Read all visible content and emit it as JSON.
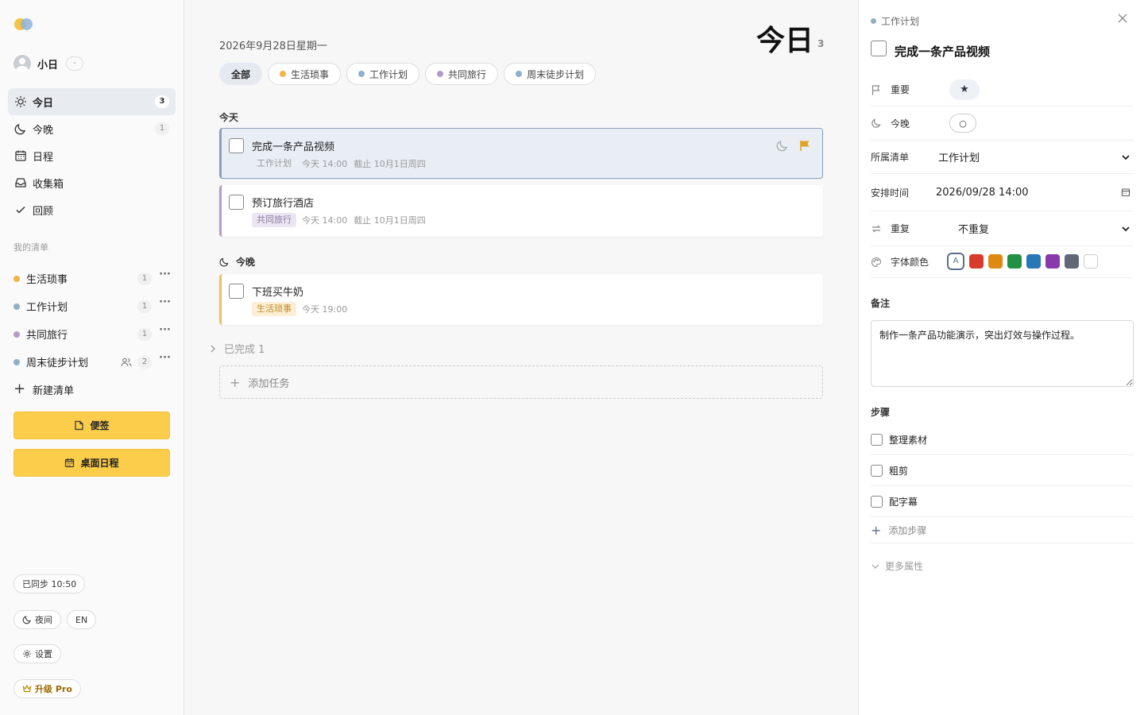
{
  "sidebar": {
    "user": {
      "name": "小日",
      "tag": "-"
    },
    "nav": [
      {
        "label": "今日",
        "count": "3",
        "icon": "sun-icon",
        "active": true
      },
      {
        "label": "今晚",
        "count": "1",
        "icon": "moon-icon"
      },
      {
        "label": "日程",
        "icon": "calendar-icon"
      },
      {
        "label": "收集箱",
        "icon": "inbox-icon"
      },
      {
        "label": "回顾",
        "icon": "check-icon"
      }
    ],
    "lists_title": "我的清单",
    "lists": [
      {
        "label": "生活琐事",
        "count": "1",
        "color": "#f0b44a"
      },
      {
        "label": "工作计划",
        "count": "1",
        "color": "#8fb0c8"
      },
      {
        "label": "共同旅行",
        "count": "1",
        "color": "#b39bc8"
      },
      {
        "label": "周末徒步计划",
        "count": "2",
        "color": "#8fb0c8",
        "shared": true
      }
    ],
    "new_list": "新建清单",
    "sticky_btn": "便签",
    "desktop_btn": "桌面日程",
    "sync": "已同步 10:50",
    "night": "夜间",
    "lang": "EN",
    "settings": "设置",
    "upgrade": "升级 Pro"
  },
  "main": {
    "date": "2026年9月28日星期一",
    "title": "今日",
    "count": "3",
    "filters": [
      {
        "label": "全部",
        "active": true
      },
      {
        "label": "生活琐事",
        "color": "#f0b44a"
      },
      {
        "label": "工作计划",
        "color": "#8fb0c8"
      },
      {
        "label": "共同旅行",
        "color": "#b39bc8"
      },
      {
        "label": "周末徒步计划",
        "color": "#8fb0c8"
      }
    ],
    "group_today": "今天",
    "group_tonight": "今晚",
    "tasks": [
      {
        "title": "完成一条产品视频",
        "tag": "工作计划",
        "time": "今天 14:00",
        "due": "截止 10月1日周四",
        "tag_color": "#e9eef5",
        "tag_text": "#999",
        "accent": "#8aa0bc"
      },
      {
        "title": "预订旅行酒店",
        "tag": "共同旅行",
        "time": "今天 14:00",
        "due": "截止 10月1日周四",
        "tag_color": "#ece6f3",
        "tag_text": "#8a7aa0",
        "accent": "#b39bc8"
      },
      {
        "title": "下班买牛奶",
        "tag": "生活琐事",
        "time": "今天 19:00",
        "tag_color": "#fcefd6",
        "tag_text": "#c08a2a",
        "accent": "#f0c060"
      }
    ],
    "completed": "已完成 1",
    "add_task": "添加任务"
  },
  "detail": {
    "list": "工作计划",
    "title": "完成一条产品视频",
    "important_label": "重要",
    "important_value": "★",
    "tonight_label": "今晚",
    "tonight_value": "○",
    "list_label": "所属清单",
    "list_value": "工作计划",
    "time_label": "安排时间",
    "time_value": "2026/09/28 14:00",
    "repeat_label": "重复",
    "repeat_value": "不重复",
    "color_label": "字体颜色",
    "color_first": "A",
    "colors": [
      "#d83a2e",
      "#de8a10",
      "#239145",
      "#2878b8",
      "#8a3aa8",
      "#5f6874",
      "#ffffff"
    ],
    "notes_label": "备注",
    "notes": "制作一条产品功能演示，突出灯效与操作过程。",
    "steps_label": "步骤",
    "steps": [
      "整理素材",
      "粗剪",
      "配字幕"
    ],
    "add_step": "添加步骤",
    "more": "更多属性"
  }
}
